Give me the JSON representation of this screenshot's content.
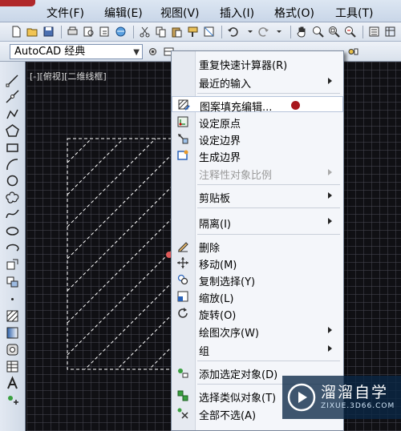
{
  "menubar": {
    "items": [
      "文件(F)",
      "编辑(E)",
      "视图(V)",
      "插入(I)",
      "格式(O)",
      "工具(T)"
    ]
  },
  "workspace": {
    "selected": "AutoCAD 经典"
  },
  "viewport": {
    "label": "[-][俯视][二维线框]"
  },
  "context_menu": {
    "items": [
      {
        "label": "重复快速计算器(R)",
        "icon": "none",
        "submenu": false,
        "disabled": false
      },
      {
        "label": "最近的输入",
        "icon": "none",
        "submenu": true,
        "disabled": false
      },
      {
        "label": "图案填充编辑...",
        "icon": "hatch-edit-icon",
        "submenu": false,
        "disabled": false,
        "highlighted": true
      },
      {
        "label": "设定原点",
        "icon": "set-origin-icon",
        "submenu": false,
        "disabled": false
      },
      {
        "label": "设定边界",
        "icon": "set-boundary-icon",
        "submenu": false,
        "disabled": false
      },
      {
        "label": "生成边界",
        "icon": "generate-boundary-icon",
        "submenu": false,
        "disabled": false
      },
      {
        "label": "注释性对象比例",
        "icon": "none",
        "submenu": true,
        "disabled": true
      },
      {
        "label": "剪贴板",
        "icon": "none",
        "submenu": true,
        "disabled": false
      },
      {
        "label": "隔离(I)",
        "icon": "none",
        "submenu": true,
        "disabled": false
      },
      {
        "label": "删除",
        "icon": "erase-icon",
        "submenu": false,
        "disabled": false
      },
      {
        "label": "移动(M)",
        "icon": "move-icon",
        "submenu": false,
        "disabled": false
      },
      {
        "label": "复制选择(Y)",
        "icon": "copy-icon",
        "submenu": false,
        "disabled": false
      },
      {
        "label": "缩放(L)",
        "icon": "scale-icon",
        "submenu": false,
        "disabled": false
      },
      {
        "label": "旋转(O)",
        "icon": "rotate-icon",
        "submenu": false,
        "disabled": false
      },
      {
        "label": "绘图次序(W)",
        "icon": "none",
        "submenu": true,
        "disabled": false
      },
      {
        "label": "组",
        "icon": "none",
        "submenu": true,
        "disabled": false
      },
      {
        "label": "添加选定对象(D)",
        "icon": "add-selected-icon",
        "submenu": false,
        "disabled": false
      },
      {
        "label": "选择类似对象(T)",
        "icon": "select-similar-icon",
        "submenu": false,
        "disabled": false
      },
      {
        "label": "全部不选(A)",
        "icon": "deselect-all-icon",
        "submenu": false,
        "disabled": false
      }
    ]
  },
  "watermark": {
    "title": "溜溜自学",
    "subtitle": "ZIXUE.3D66.COM"
  },
  "colors": {
    "canvas_bg": "#101014",
    "hatch": "#ffffff",
    "menu_bg": "#f4f6fa",
    "marker": "#a8161c"
  }
}
